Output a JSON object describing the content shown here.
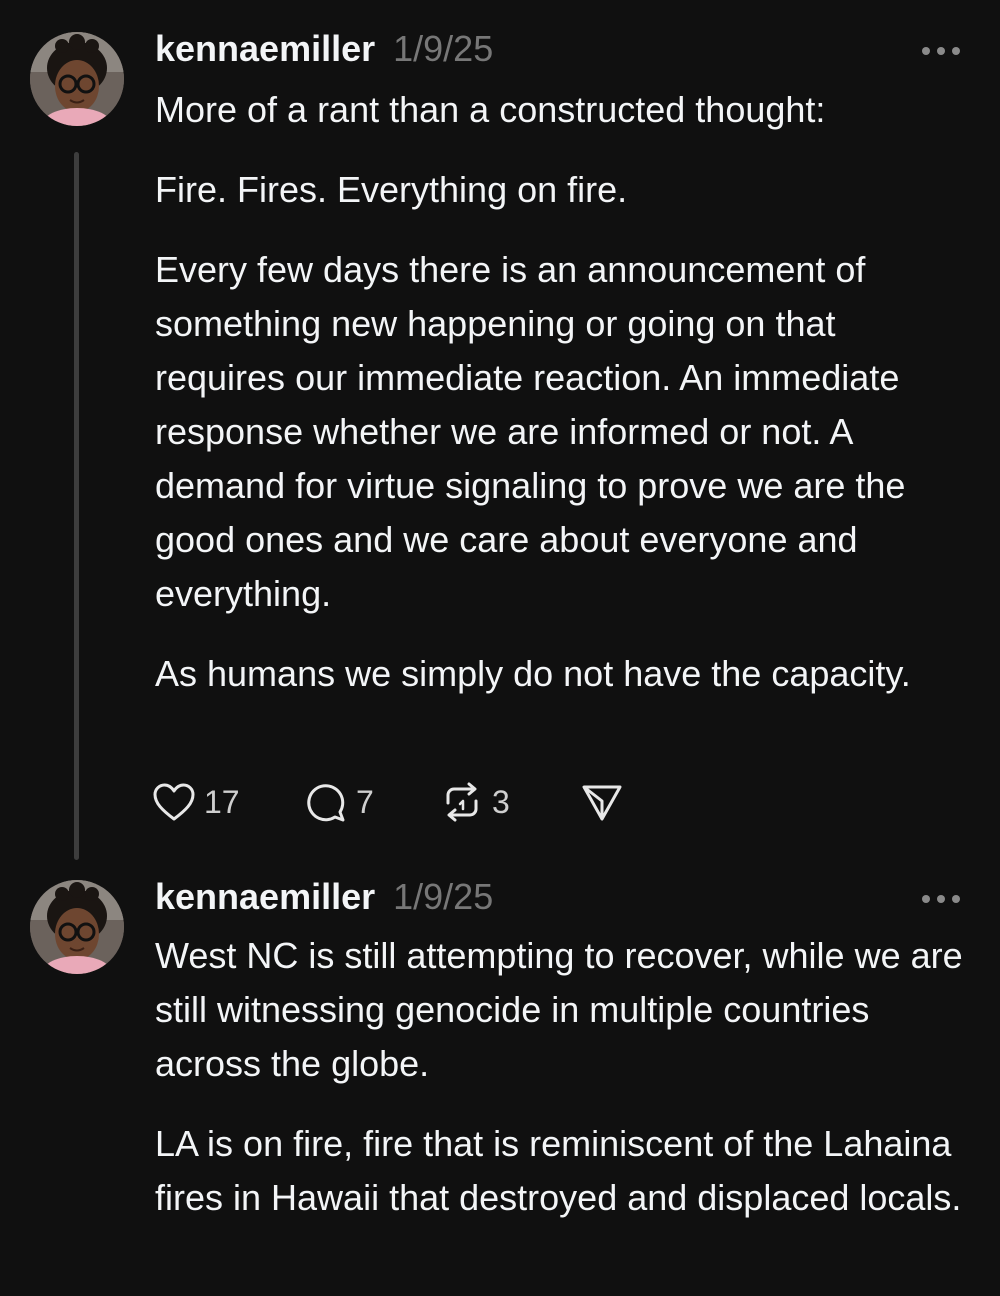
{
  "colors": {
    "background": "#101010",
    "text": "#f3f5f7",
    "muted": "#777777",
    "thread_line": "#3d3d3d"
  },
  "posts": [
    {
      "username": "kennaemiller",
      "timestamp": "1/9/25",
      "avatar_icon": "avatar-photo",
      "more_icon": "more-horizontal-icon",
      "paragraphs": [
        "More of a rant than a constructed thought:",
        "Fire. Fires. Everything on fire.",
        "Every few days there is an announcement of something new happening or going on that requires our immediate reaction. An immediate response whether we are informed or not. A demand for virtue signaling to prove we are the good ones and we care about everyone and everything.",
        "As humans we simply do not have the capacity."
      ],
      "actions": {
        "likes": "17",
        "replies": "7",
        "reposts": "3"
      }
    },
    {
      "username": "kennaemiller",
      "timestamp": "1/9/25",
      "avatar_icon": "avatar-photo",
      "more_icon": "more-horizontal-icon",
      "paragraphs": [
        "West NC is still attempting to recover, while we are still witnessing genocide in multiple countries across the globe.",
        "LA is on fire, fire that is reminiscent of the Lahaina fires in Hawaii that destroyed and displaced locals."
      ]
    }
  ]
}
